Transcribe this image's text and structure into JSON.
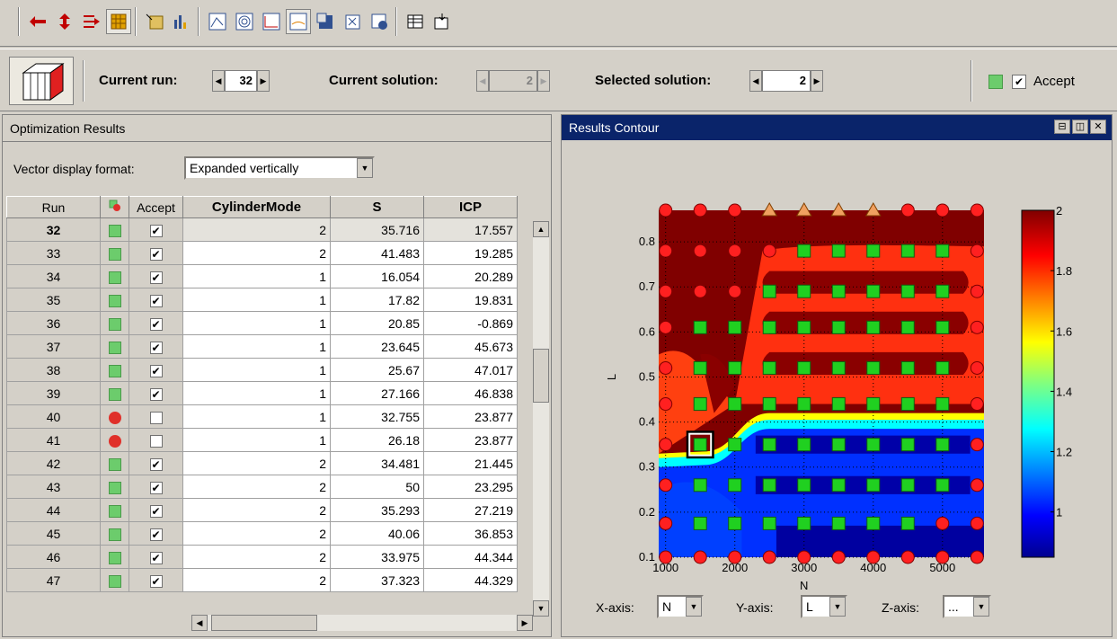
{
  "runbar": {
    "current_run_label": "Current run:",
    "current_run_value": "32",
    "current_solution_label": "Current solution:",
    "current_solution_value": "2",
    "selected_solution_label": "Selected solution:",
    "selected_solution_value": "2",
    "accept_label": "Accept",
    "accept_checked": true
  },
  "left_panel": {
    "title": "Optimization Results",
    "vector_format_label": "Vector display format:",
    "vector_format_value": "Expanded vertically",
    "columns": [
      "Run",
      "",
      "Accept",
      "CylinderMode",
      "S",
      "ICP"
    ],
    "rows": [
      {
        "run": "32",
        "status": "ok",
        "accept": true,
        "cyl": "2",
        "s": "35.716",
        "icp": "17.557"
      },
      {
        "run": "33",
        "status": "ok",
        "accept": true,
        "cyl": "2",
        "s": "41.483",
        "icp": "19.285"
      },
      {
        "run": "34",
        "status": "ok",
        "accept": true,
        "cyl": "1",
        "s": "16.054",
        "icp": "20.289"
      },
      {
        "run": "35",
        "status": "ok",
        "accept": true,
        "cyl": "1",
        "s": "17.82",
        "icp": "19.831"
      },
      {
        "run": "36",
        "status": "ok",
        "accept": true,
        "cyl": "1",
        "s": "20.85",
        "icp": "-0.869"
      },
      {
        "run": "37",
        "status": "ok",
        "accept": true,
        "cyl": "1",
        "s": "23.645",
        "icp": "45.673"
      },
      {
        "run": "38",
        "status": "ok",
        "accept": true,
        "cyl": "1",
        "s": "25.67",
        "icp": "47.017"
      },
      {
        "run": "39",
        "status": "ok",
        "accept": true,
        "cyl": "1",
        "s": "27.166",
        "icp": "46.838"
      },
      {
        "run": "40",
        "status": "fail",
        "accept": false,
        "cyl": "1",
        "s": "32.755",
        "icp": "23.877"
      },
      {
        "run": "41",
        "status": "fail",
        "accept": false,
        "cyl": "1",
        "s": "26.18",
        "icp": "23.877"
      },
      {
        "run": "42",
        "status": "ok",
        "accept": true,
        "cyl": "2",
        "s": "34.481",
        "icp": "21.445"
      },
      {
        "run": "43",
        "status": "ok",
        "accept": true,
        "cyl": "2",
        "s": "50",
        "icp": "23.295"
      },
      {
        "run": "44",
        "status": "ok",
        "accept": true,
        "cyl": "2",
        "s": "35.293",
        "icp": "27.219"
      },
      {
        "run": "45",
        "status": "ok",
        "accept": true,
        "cyl": "2",
        "s": "40.06",
        "icp": "36.853"
      },
      {
        "run": "46",
        "status": "ok",
        "accept": true,
        "cyl": "2",
        "s": "33.975",
        "icp": "44.344"
      },
      {
        "run": "47",
        "status": "ok",
        "accept": true,
        "cyl": "2",
        "s": "37.323",
        "icp": "44.329"
      }
    ]
  },
  "right_panel": {
    "title": "Results Contour",
    "x_axis_label": "X-axis:",
    "x_axis_value": "N",
    "y_axis_label": "Y-axis:",
    "y_axis_value": "L",
    "z_axis_label": "Z-axis:",
    "z_axis_value": "..."
  },
  "chart_data": {
    "type": "heatmap",
    "xlabel": "N",
    "ylabel": "L",
    "xlim": [
      900,
      5600
    ],
    "ylim": [
      0.1,
      0.87
    ],
    "x_ticks": [
      "1000",
      "2000",
      "3000",
      "4000",
      "5000"
    ],
    "y_ticks": [
      "0.1",
      "0.2",
      "0.3",
      "0.4",
      "0.5",
      "0.6",
      "0.7",
      "0.8"
    ],
    "colorbar_ticks": [
      "2",
      "1.8",
      "1.6",
      "1.4",
      "1.2",
      "1"
    ],
    "colorbar_range": [
      0.85,
      2
    ],
    "colors": {
      "high": "#800000",
      "mid": "#ffff00",
      "low": "#0000a0"
    }
  }
}
